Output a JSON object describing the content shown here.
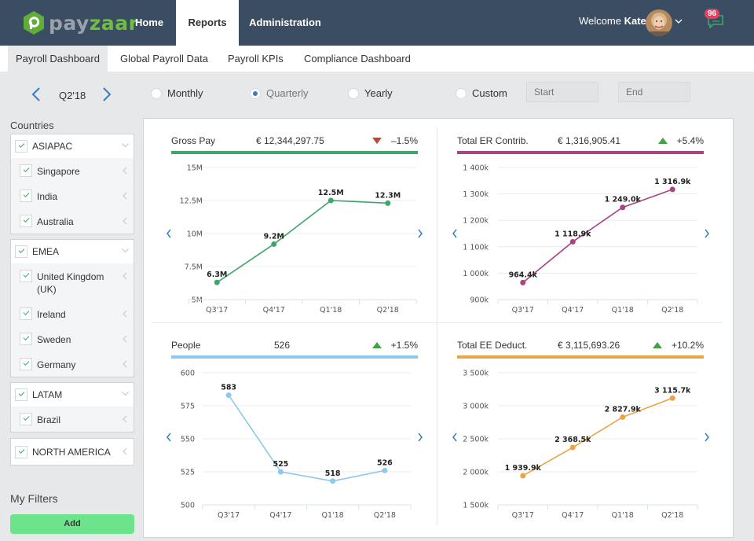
{
  "brand": {
    "name_part1": "pay",
    "name_part2": "zaar"
  },
  "topnav": {
    "items": [
      {
        "label": "Home",
        "active": false
      },
      {
        "label": "Reports",
        "active": true
      },
      {
        "label": "Administration",
        "active": false
      }
    ],
    "welcome_prefix": "Welcome",
    "user_name": "Kate",
    "messages_count": "96"
  },
  "subnav": {
    "tabs": [
      {
        "label": "Payroll Dashboard",
        "active": true
      },
      {
        "label": "Global Payroll Data",
        "active": false
      },
      {
        "label": "Payroll KPIs",
        "active": false
      },
      {
        "label": "Compliance Dashboard",
        "active": false
      }
    ]
  },
  "filters": {
    "period": "Q2'18",
    "granularity": [
      {
        "label": "Monthly",
        "selected": false
      },
      {
        "label": "Quarterly",
        "selected": true
      },
      {
        "label": "Yearly",
        "selected": false
      },
      {
        "label": "Custom",
        "selected": false
      }
    ],
    "start_placeholder": "Start",
    "end_placeholder": "End"
  },
  "sidebar": {
    "countries_title": "Countries",
    "groups": [
      {
        "name": "ASIAPAC",
        "checked": true,
        "expanded": true,
        "children": [
          "Singapore",
          "India",
          "Australia"
        ]
      },
      {
        "name": "EMEA",
        "checked": true,
        "expanded": true,
        "children": [
          "United Kingdom (UK)",
          "Ireland",
          "Sweden",
          "Germany"
        ]
      },
      {
        "name": "LATAM",
        "checked": true,
        "expanded": true,
        "children": [
          "Brazil"
        ]
      },
      {
        "name": "NORTH AMERICA",
        "checked": true,
        "expanded": false,
        "children": []
      }
    ],
    "my_filters_title": "My Filters",
    "add_label": "Add"
  },
  "colors": {
    "nav_bg": "#3b4d63",
    "gross_pay": "#3fa66b",
    "er_contrib": "#a8447f",
    "people": "#8ec8ec",
    "ee_deduct": "#eaa448",
    "trend_up": "#43a047",
    "trend_down": "#c0443a",
    "add_button": "#6de48c",
    "badge": "#e5405e"
  },
  "chart_data": [
    {
      "type": "line",
      "title": "Gross Pay",
      "total": "€ 12,344,297.75",
      "trend": "–1.5%",
      "trend_direction": "down",
      "categories": [
        "Q3'17",
        "Q4'17",
        "Q1'18",
        "Q2'18"
      ],
      "values": [
        6.3,
        9.2,
        12.5,
        12.3
      ],
      "data_labels": [
        "6.3M",
        "9.2M",
        "12.5M",
        "12.3M"
      ],
      "yticks": [
        "5M",
        "7.5M",
        "10M",
        "12.5M",
        "15M"
      ],
      "ylim": [
        5,
        15
      ],
      "unit": "M EUR",
      "color_key": "gross_pay"
    },
    {
      "type": "line",
      "title": "Total ER Contrib.",
      "total": "€ 1,316,905.41",
      "trend": "+5.4%",
      "trend_direction": "up",
      "categories": [
        "Q3'17",
        "Q4'17",
        "Q1'18",
        "Q2'18"
      ],
      "values": [
        964.4,
        1118.9,
        1249.0,
        1316.9
      ],
      "data_labels": [
        "964.4k",
        "1 118.9k",
        "1 249.0k",
        "1 316.9k"
      ],
      "yticks": [
        "900k",
        "1 000k",
        "1 100k",
        "1 200k",
        "1 300k",
        "1 400k"
      ],
      "ylim": [
        900,
        1400
      ],
      "unit": "k EUR",
      "color_key": "er_contrib"
    },
    {
      "type": "line",
      "title": "People",
      "total": "526",
      "trend": "+1.5%",
      "trend_direction": "up",
      "categories": [
        "Q3'17",
        "Q4'17",
        "Q1'18",
        "Q2'18"
      ],
      "values": [
        583,
        525,
        518,
        526
      ],
      "data_labels": [
        "583",
        "525",
        "518",
        "526"
      ],
      "yticks": [
        "500",
        "525",
        "550",
        "575",
        "600"
      ],
      "ylim": [
        500,
        600
      ],
      "unit": "people",
      "color_key": "people"
    },
    {
      "type": "line",
      "title": "Total EE Deduct.",
      "total": "€ 3,115,693.26",
      "trend": "+10.2%",
      "trend_direction": "up",
      "categories": [
        "Q3'17",
        "Q4'17",
        "Q1'18",
        "Q2'18"
      ],
      "values": [
        1939.9,
        2368.5,
        2827.9,
        3115.7
      ],
      "data_labels": [
        "1 939.9k",
        "2 368.5k",
        "2 827.9k",
        "3 115.7k"
      ],
      "yticks": [
        "1 500k",
        "2 000k",
        "2 500k",
        "3 000k",
        "3 500k"
      ],
      "ylim": [
        1500,
        3500
      ],
      "unit": "k EUR",
      "color_key": "ee_deduct"
    }
  ]
}
